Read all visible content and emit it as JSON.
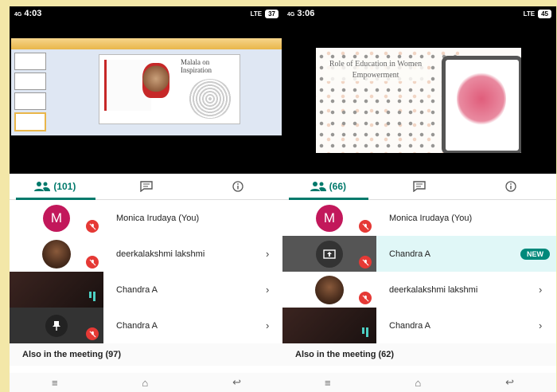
{
  "left": {
    "status": {
      "time": "4:03",
      "signal": "4G",
      "net": "LTE",
      "battery": "37"
    },
    "slide": {
      "title": "Malala on Inspiration"
    },
    "tabs": {
      "people_count": "(101)"
    },
    "participants": [
      {
        "name": "Monica Irudaya (You)",
        "avatar_letter": "M"
      },
      {
        "name": "deerkalakshmi lakshmi"
      },
      {
        "name": "Chandra A"
      },
      {
        "name": "Chandra A"
      }
    ],
    "also": "Also in the meeting (97)"
  },
  "right": {
    "status": {
      "time": "3:06",
      "signal": "4G",
      "net": "LTE",
      "battery": "45"
    },
    "slide": {
      "title": "Role of Education in Women Empowerment"
    },
    "tabs": {
      "people_count": "(66)"
    },
    "participants": [
      {
        "name": "Monica Irudaya (You)",
        "avatar_letter": "M"
      },
      {
        "name": "Chandra A",
        "badge": "NEW"
      },
      {
        "name": "deerkalakshmi lakshmi"
      },
      {
        "name": "Chandra A"
      }
    ],
    "also": "Also in the meeting (62)"
  },
  "colors": {
    "accent": "#00796b",
    "mute": "#e53935",
    "avatar": "#c2185b"
  },
  "icons": [
    "people-icon",
    "chat-icon",
    "info-icon",
    "mic-off-icon",
    "present-icon",
    "pin-icon",
    "chevron-right-icon",
    "menu-nav-icon",
    "home-nav-icon",
    "back-nav-icon"
  ]
}
